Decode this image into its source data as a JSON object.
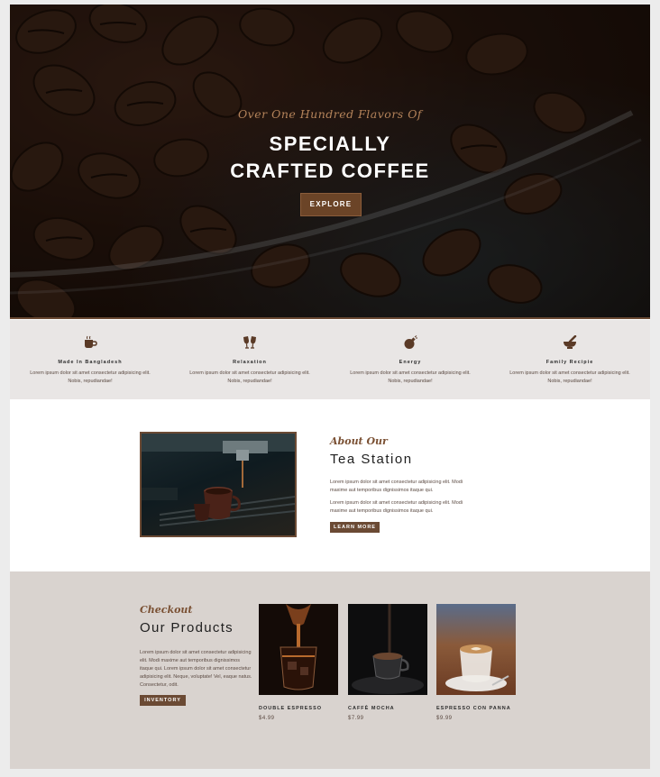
{
  "hero": {
    "subtitle": "Over One Hundred Flavors Of",
    "title_line1": "SPECIALLY",
    "title_line2": "CRAFTED COFFEE",
    "button": "EXPLORE"
  },
  "features": [
    {
      "icon": "coffee-cup-icon",
      "title": "Made In Bangladesh",
      "desc": "Lorem ipsum dolor sit amet consectetur adipisicing elit. Nobis, repudiandae!"
    },
    {
      "icon": "cheers-glasses-icon",
      "title": "Relaxation",
      "desc": "Lorem ipsum dolor sit amet consectetur adipisicing elit. Nobis, repudiandae!"
    },
    {
      "icon": "bomb-icon",
      "title": "Energy",
      "desc": "Lorem ipsum dolor sit amet consectetur adipisicing elit. Nobis, repudiandae!"
    },
    {
      "icon": "mortar-pestle-icon",
      "title": "Family Recipie",
      "desc": "Lorem ipsum dolor sit amet consectetur adipisicing elit. Nobis, repudiandae!"
    }
  ],
  "about": {
    "kicker": "About Our",
    "title": "Tea Station",
    "p1": "Lorem ipsum dolor sit amet consectetur adipisicing elit. Modi maxime aut temporibus dignissimos itaque qui.",
    "p2": "Lorem ipsum dolor sit amet consectetur adipisicing elit. Modi maxime aut temporibus dignissimos itaque qui.",
    "button": "LEARN MORE"
  },
  "products": {
    "kicker": "Checkout",
    "title": "Our Products",
    "desc": "Lorem ipsum dolor sit amet consectetur adipisicing elit. Modi maxime aut temporibus dignissimos itaque qui. Lorem ipsum dolor sit amet consectetur adipisicing elit. Neque, voluptate! Vel, eaque natus. Consectetur, odit.",
    "button": "INVENTORY",
    "items": [
      {
        "name": "DOUBLE ESPRESSO",
        "price": "$4.99"
      },
      {
        "name": "CAFFÈ MOCHA",
        "price": "$7.99"
      },
      {
        "name": "ESPRESSO CON PANNA",
        "price": "$9.99"
      }
    ]
  },
  "colors": {
    "accent_brown": "#6b4a34",
    "kicker_brown": "#7a5033",
    "features_bg": "#e9e6e5",
    "products_bg": "#d9d3cf"
  }
}
